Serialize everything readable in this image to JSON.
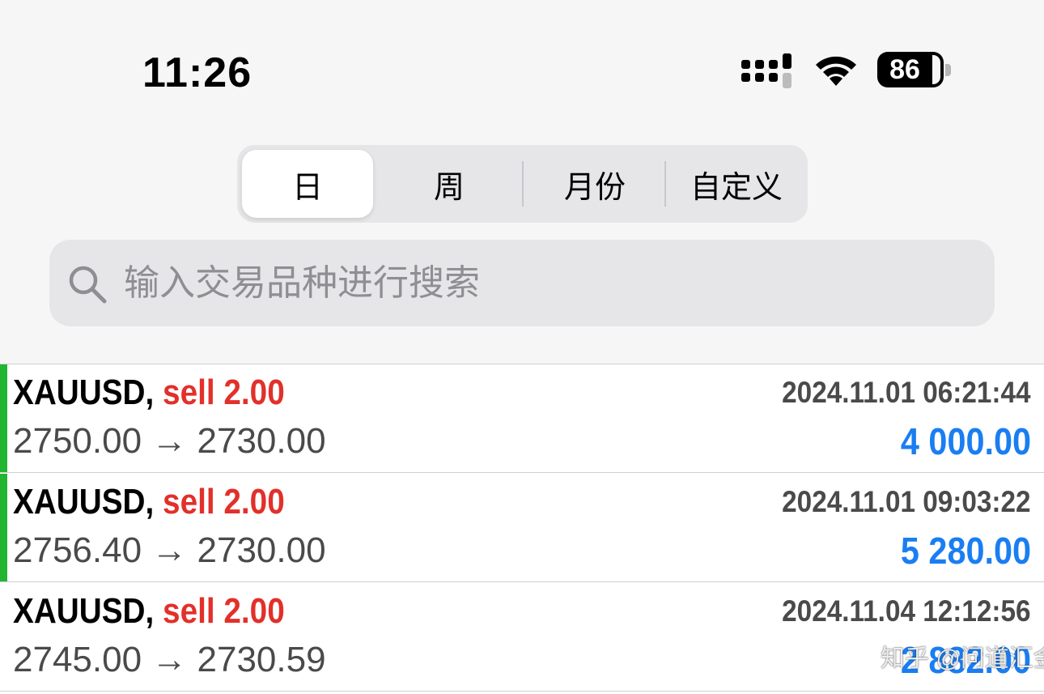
{
  "status_bar": {
    "time": "11:26",
    "battery": "86",
    "icons": [
      "signal-icon",
      "wifi-icon",
      "battery-icon"
    ]
  },
  "period_tabs": {
    "selected": "日",
    "items": [
      {
        "label": "日"
      },
      {
        "label": "周"
      },
      {
        "label": "月份"
      },
      {
        "label": "自定义"
      }
    ]
  },
  "search": {
    "placeholder": "输入交易品种进行搜索",
    "value": ""
  },
  "trades": [
    {
      "symbol": "XAUUSD,",
      "side": "sell 2.00",
      "datetime": "2024.11.01 06:21:44",
      "prices": "2750.00 → 2730.00",
      "profit": "4 000.00",
      "marker": true
    },
    {
      "symbol": "XAUUSD,",
      "side": "sell 2.00",
      "datetime": "2024.11.01 09:03:22",
      "prices": "2756.40 → 2730.00",
      "profit": "5 280.00",
      "marker": true
    },
    {
      "symbol": "XAUUSD,",
      "side": "sell 2.00",
      "datetime": "2024.11.04 12:12:56",
      "prices": "2745.00 → 2730.59",
      "profit": "2 882.00",
      "marker": false
    }
  ],
  "watermark": "知乎 @问道汇金",
  "colors": {
    "sell": "#e2302a",
    "profit": "#1a7ef2",
    "marker": "#22b531",
    "background_top": "#f6f6f6"
  }
}
